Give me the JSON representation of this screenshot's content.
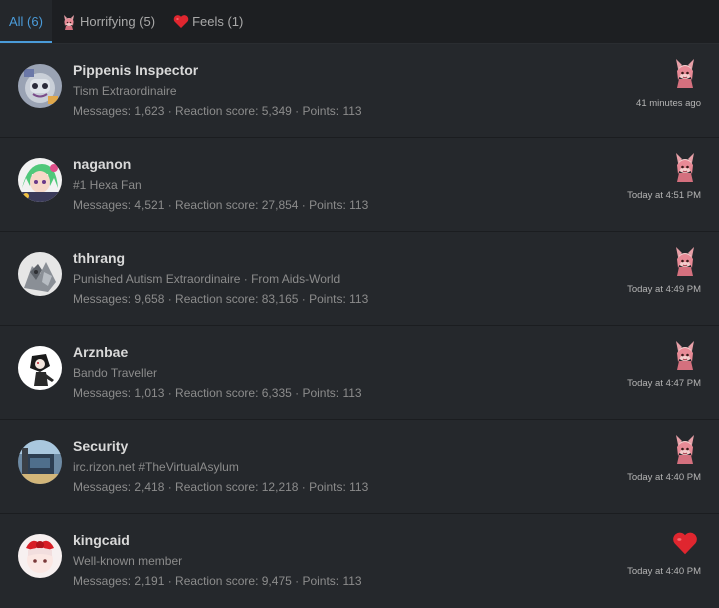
{
  "tabs": [
    {
      "label": "All (6)",
      "icon": "none"
    },
    {
      "label": "Horrifying (5)",
      "icon": "horrifying-reaction-icon"
    },
    {
      "label": "Feels (1)",
      "icon": "heart-icon"
    }
  ],
  "colors": {
    "accent": "#4a9bd9",
    "background": "#25282c",
    "heart": "#e0262f"
  },
  "members": [
    {
      "name": "Pippenis Inspector",
      "title": "Tism Extraordinaire",
      "stats": "Messages: 1,623 · Reaction score: 5,349 · Points: 113",
      "reaction": "horrifying-reaction-icon",
      "time": "41 minutes ago"
    },
    {
      "name": "naganon",
      "title": "#1 Hexa Fan",
      "stats": "Messages: 4,521 · Reaction score: 27,854 · Points: 113",
      "reaction": "horrifying-reaction-icon",
      "time": "Today at 4:51 PM"
    },
    {
      "name": "thhrang",
      "title": "Punished Autism Extraordinaire · From Aids-World",
      "stats": "Messages: 9,658 · Reaction score: 83,165 · Points: 113",
      "reaction": "horrifying-reaction-icon",
      "time": "Today at 4:49 PM"
    },
    {
      "name": "Arznbae",
      "title": "Bando Traveller",
      "stats": "Messages: 1,013 · Reaction score: 6,335 · Points: 113",
      "reaction": "horrifying-reaction-icon",
      "time": "Today at 4:47 PM"
    },
    {
      "name": "Security",
      "title": "irc.rizon.net #TheVirtualAsylum",
      "stats": "Messages: 2,418 · Reaction score: 12,218 · Points: 113",
      "reaction": "horrifying-reaction-icon",
      "time": "Today at 4:40 PM"
    },
    {
      "name": "kingcaid",
      "title": "Well-known member",
      "stats": "Messages: 2,191 · Reaction score: 9,475 · Points: 113",
      "reaction": "heart-icon",
      "time": "Today at 4:40 PM"
    }
  ]
}
